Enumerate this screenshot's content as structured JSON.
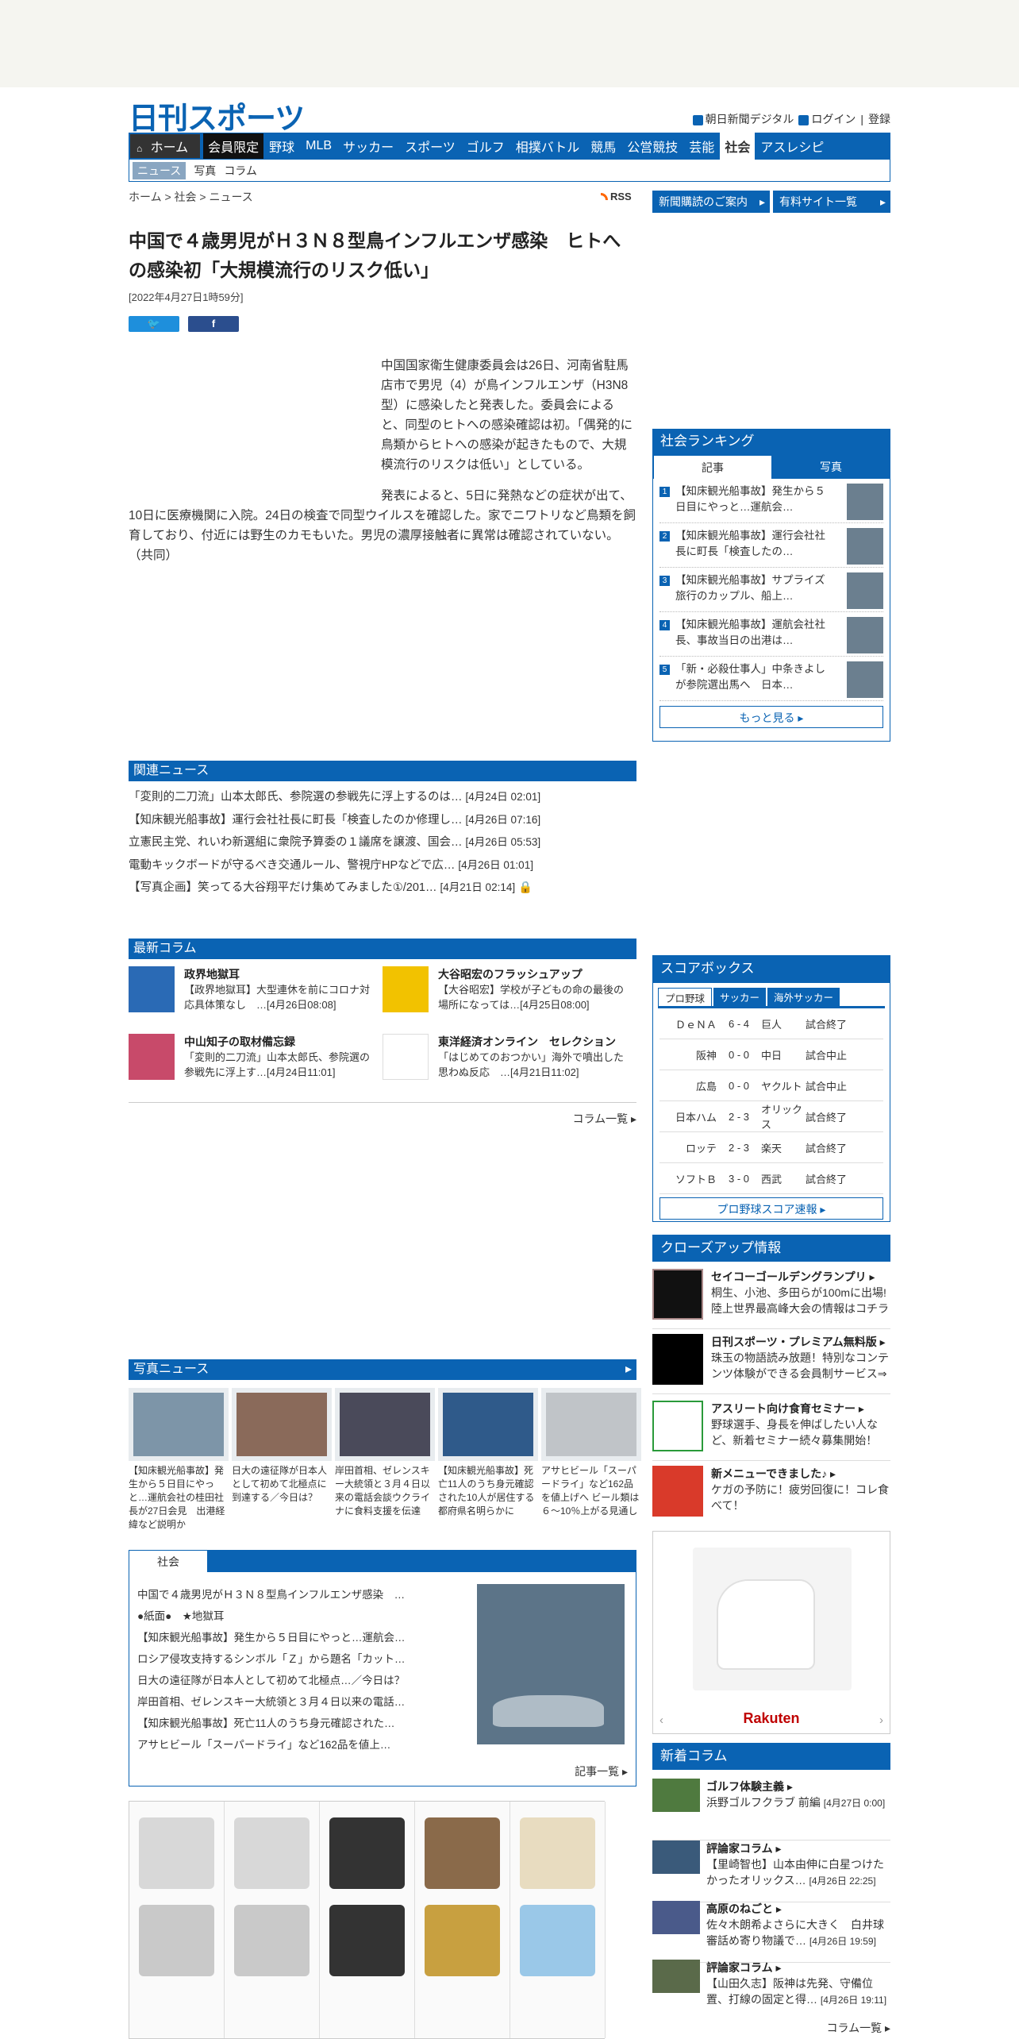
{
  "header": {
    "logo": "日刊スポーツ",
    "links": [
      "朝日新聞デジタル",
      "ログイン",
      "登録"
    ]
  },
  "nav": {
    "home": "ホーム",
    "member": "会員限定",
    "items": [
      "野球",
      "MLB",
      "サッカー",
      "スポーツ",
      "ゴルフ",
      "相撲バトル",
      "競馬",
      "公営競技",
      "芸能"
    ],
    "active": "社会",
    "last": "アスレシピ"
  },
  "subnav": [
    "ニュース",
    "写真",
    "コラム"
  ],
  "breadcrumb": "ホーム > 社会 > ニュース",
  "rss": "RSS",
  "article": {
    "title": "中国で４歳男児がＨ３Ｎ８型鳥インフルエンザ感染　ヒトへの感染初「大規模流行のリスク低い」",
    "date": "[2022年4月27日1時59分]",
    "p1": "中国国家衛生健康委員会は26日、河南省駐馬店市で男児（4）が鳥インフルエンザ（H3N8型）に感染したと発表した。委員会によると、同型のヒトへの感染確認は初。「偶発的に鳥類からヒトへの感染が起きたもので、大規模流行のリスクは低い」としている。",
    "p2": "発表によると、5日に発熱などの症状が出て、10日に医療機関に入院。24日の検査で同型ウイルスを確認した。家でニワトリなど鳥類を飼育しており、付近には野生のカモもいた。男児の濃厚接触者に異常は確認されていない。（共同）"
  },
  "right_buttons": [
    "新聞購読のご案内",
    "有料サイト一覧"
  ],
  "ranking": {
    "title": "社会ランキング",
    "tabs": [
      "記事",
      "写真"
    ],
    "items": [
      "【知床観光船事故】発生から５日目にやっと…運航会…",
      "【知床観光船事故】運行会社社長に町長「検査したの…",
      "【知床観光船事故】サプライズ旅行のカップル、船上…",
      "【知床観光船事故】運航会社社長、事故当日の出港は…",
      "「新・必殺仕事人」中条きよしが参院選出馬へ　日本…"
    ],
    "more": "もっと見る"
  },
  "related": {
    "title": "関連ニュース",
    "items": [
      {
        "t": "「変則的二刀流」山本太郎氏、参院選の参戦先に浮上するのは…",
        "d": "[4月24日 02:01]"
      },
      {
        "t": "【知床観光船事故】運行会社社長に町長「検査したのか修理し…",
        "d": "[4月26日 07:16]"
      },
      {
        "t": "立憲民主党、れいわ新選組に衆院予算委の１議席を譲渡、国会…",
        "d": "[4月26日 05:53]"
      },
      {
        "t": "電動キックボードが守るべき交通ルール、警視庁HPなどで広…",
        "d": "[4月26日 01:01]"
      },
      {
        "t": "【写真企画】笑ってる大谷翔平だけ集めてみました①/201…",
        "d": "[4月21日 02:14]"
      }
    ]
  },
  "latest": {
    "title": "最新コラム",
    "items": [
      {
        "h": "政界地獄耳",
        "t": "【政界地獄耳】大型連休を前にコロナ対応具体策なし　…[4月26日08:08]",
        "img": "政界地獄耳"
      },
      {
        "h": "大谷昭宏のフラッシュアップ",
        "t": "【大谷昭宏】学校が子どもの命の最後の場所になっては…[4月25日08:00]",
        "img": "フラッシュアップ"
      },
      {
        "h": "中山知子の取材備忘録",
        "t": "「変則的二刀流」山本太郎氏、参院選の参戦先に浮上す…[4月24日11:01]",
        "img": "中山知子"
      },
      {
        "h": "東洋経済オンライン　セレクション",
        "t": "「はじめてのおつかい」海外で噴出した思わぬ反応　…[4月21日11:02]",
        "img": "東洋経済"
      }
    ],
    "more": "コラム一覧"
  },
  "scorebox": {
    "title": "スコアボックス",
    "tabs": [
      "プロ野球",
      "サッカー",
      "海外サッカー"
    ],
    "rows": [
      [
        "ＤｅＮＡ",
        "6 - 4",
        "巨人",
        "試合終了"
      ],
      [
        "阪神",
        "0 - 0",
        "中日",
        "試合中止"
      ],
      [
        "広島",
        "0 - 0",
        "ヤクルト",
        "試合中止"
      ],
      [
        "日本ハム",
        "2 - 3",
        "オリックス",
        "試合終了"
      ],
      [
        "ロッテ",
        "2 - 3",
        "楽天",
        "試合終了"
      ],
      [
        "ソフトＢ",
        "3 - 0",
        "西武",
        "試合終了"
      ]
    ],
    "more": "プロ野球スコア速報"
  },
  "closeup": {
    "title": "クローズアップ情報",
    "items": [
      {
        "h": "セイコーゴールデングランプリ",
        "t": "桐生、小池、多田らが100mに出場!陸上世界最高峰大会の情報はコチラ"
      },
      {
        "h": "日刊スポーツ・プレミアム無料版",
        "t": "珠玉の物語読み放題！特別なコンテンツ体験ができる会員制サービス⇒"
      },
      {
        "h": "アスリート向け食育セミナー",
        "t": "野球選手、身長を伸ばしたい人など、新着セミナー続々募集開始！"
      },
      {
        "h": "新メニューできました♪",
        "t": "ケガの予防に！疲労回復に！コレ食べて！"
      }
    ]
  },
  "ad": {
    "brand": "Rakuten"
  },
  "newcolumn": {
    "title": "新着コラム",
    "items": [
      {
        "h": "ゴルフ体験主義",
        "t": "浜野ゴルフクラブ 前編",
        "d": "[4月27日 0:00]"
      },
      {
        "h": "評論家コラム",
        "t": "【里崎智也】山本由伸に白星つけたかったオリックス…",
        "d": "[4月26日 22:25]"
      },
      {
        "h": "高原のねごと",
        "t": "佐々木朗希よさらに大きく　白井球審話め寄り物議で…",
        "d": "[4月26日 19:59]"
      },
      {
        "h": "評論家コラム",
        "t": "【山田久志】阪神は先発、守備位置、打線の固定と得…",
        "d": "[4月26日 19:11]"
      }
    ],
    "more": "コラム一覧"
  },
  "photo": {
    "title": "写真ニュース",
    "items": [
      "【知床観光船事故】発生から５日目にやっと…運航会社の桂田社長が27日会見　出港経緯など説明か",
      "日大の遠征隊が日本人として初めて北極点に到達する／今日は？",
      "岸田首相、ゼレンスキー大統領と３月４日以来の電話会談ウクライナに食料支援を伝達",
      "【知床観光船事故】死亡11人のうち身元確認された10人が居住する都府県名明らかに",
      "アサヒビール「スーパードライ」など162品を値上げへ ビール類は６～10％上がる見通し"
    ]
  },
  "shakai": {
    "tab": "社会",
    "items": [
      "中国で４歳男児がＨ３Ｎ８型鳥インフルエンザ感染　…",
      "●紙面●　★地獄耳",
      "【知床観光船事故】発生から５日目にやっと…運航会…",
      "ロシア侵攻支持するシンボル「Ｚ」から題名「カット…",
      "日大の遠征隊が日本人として初めて北極点…／今日は？",
      "岸田首相、ゼレンスキー大統領と３月４日以来の電話…",
      "【知床観光船事故】死亡11人のうち身元確認された…",
      "アサヒビール「スーパードライ」など162品を値上…"
    ],
    "more": "記事一覧"
  },
  "colors": {
    "brand": "#0a63b3"
  }
}
